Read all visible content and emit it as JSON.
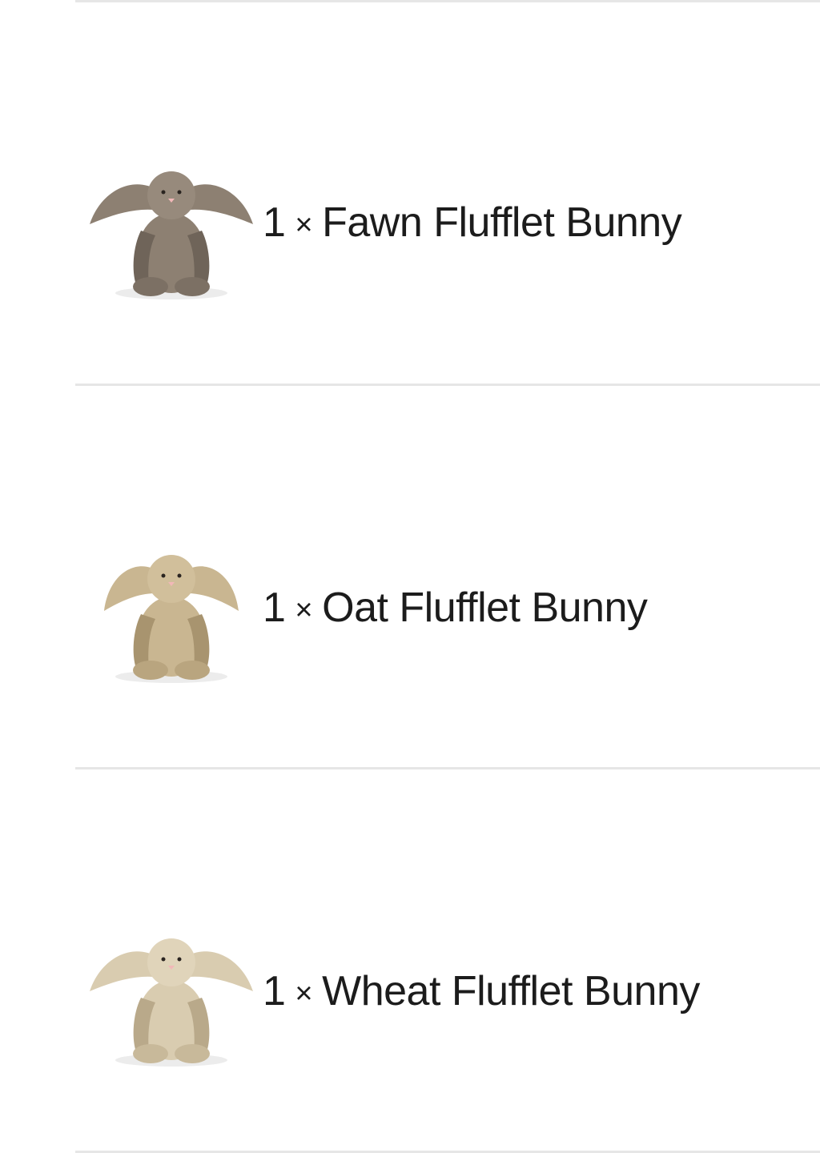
{
  "order_items": [
    {
      "quantity": "1",
      "times_symbol": "×",
      "name": "Fawn Flufflet Bunny",
      "image": "fawn-bunny-plush",
      "fur_color": "#8d8072",
      "fur_shadow": "#6f6459"
    },
    {
      "quantity": "1",
      "times_symbol": "×",
      "name": "Oat Flufflet Bunny",
      "image": "oat-bunny-plush",
      "fur_color": "#c9b691",
      "fur_shadow": "#a8946f"
    },
    {
      "quantity": "1",
      "times_symbol": "×",
      "name": "Wheat Flufflet Bunny",
      "image": "wheat-bunny-plush",
      "fur_color": "#d9ccb0",
      "fur_shadow": "#b9a98a"
    }
  ],
  "colors": {
    "divider": "#e6e6e6",
    "text": "#1c1c1c",
    "nose": "#f2b8b8"
  }
}
